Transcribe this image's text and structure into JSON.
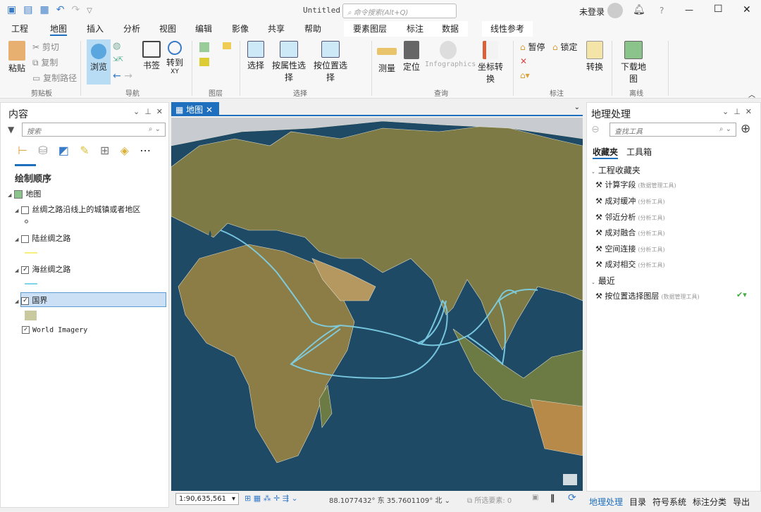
{
  "window": {
    "title": "Untitled",
    "search_placeholder": "命令搜索(Alt+Q)",
    "user": "未登录",
    "help": "?",
    "minimize": "—",
    "maximize": "☐",
    "close": "✕"
  },
  "menu_tabs": [
    "工程",
    "地图",
    "插入",
    "分析",
    "视图",
    "编辑",
    "影像",
    "共享",
    "帮助"
  ],
  "active_tab": "地图",
  "context_tabs": [
    "要素图层",
    "标注",
    "数据"
  ],
  "context_tab2": "线性参考",
  "ribbon": {
    "clipboard": {
      "paste": "粘贴",
      "cut": "剪切",
      "copy": "复制",
      "copy_path": "复制路径",
      "group": "剪贴板"
    },
    "navigate": {
      "explore": "浏览",
      "bookmarks": "书签",
      "goto": "转到",
      "goto_sub": "XY",
      "group": "导航"
    },
    "layer": {
      "group": "图层"
    },
    "selection": {
      "select": "选择",
      "by_attr": "按属性选择",
      "by_loc": "按位置选择",
      "group": "选择"
    },
    "inquiry": {
      "measure": "测量",
      "locate": "定位",
      "infographics": "Infographics",
      "convert_coord": "坐标转换",
      "group": "查询"
    },
    "labeling": {
      "pause": "暂停",
      "lock": "锁定",
      "convert": "转换",
      "group": "标注"
    },
    "offline": {
      "download": "下载地图",
      "group": "离线"
    }
  },
  "contents": {
    "title": "内容",
    "search_placeholder": "搜索",
    "drawing_order": "绘制顺序",
    "map": "地图",
    "layers": [
      {
        "name": "丝绸之路沿线上的城镇或者地区",
        "checked": false
      },
      {
        "name": "陆丝绸之路",
        "checked": false,
        "color": "#f5f07a"
      },
      {
        "name": "海丝绸之路",
        "checked": true,
        "color": "#7fd3ea"
      },
      {
        "name": "国界",
        "checked": true,
        "selected": true,
        "color": "#c9c9a0"
      },
      {
        "name": "World Imagery",
        "checked": true
      }
    ]
  },
  "map_tab": {
    "label": "地图"
  },
  "status": {
    "scale": "1:90,635,561",
    "coords": "88.1077432° 东 35.7601109° 北",
    "selected": "所选要素: 0"
  },
  "geoprocessing": {
    "title": "地理处理",
    "search_placeholder": "查找工具",
    "tabs": [
      "收藏夹",
      "工具箱"
    ],
    "project_fav": "工程收藏夹",
    "tools": [
      {
        "name": "计算字段",
        "box": "(数据管理工具)"
      },
      {
        "name": "成对缓冲",
        "box": "(分析工具)"
      },
      {
        "name": "邻近分析",
        "box": "(分析工具)"
      },
      {
        "name": "成对融合",
        "box": "(分析工具)"
      },
      {
        "name": "空间连接",
        "box": "(分析工具)"
      },
      {
        "name": "成对相交",
        "box": "(分析工具)"
      }
    ],
    "recent_label": "最近",
    "recent": [
      {
        "name": "按位置选择图层",
        "box": "(数据管理工具)"
      }
    ]
  },
  "bottom_tabs": [
    "地理处理",
    "目录",
    "符号系统",
    "标注分类",
    "导出"
  ],
  "colors": {
    "accent": "#1f6fbf",
    "selected_row": "#cce0f5",
    "sea_route": "#7fd3ea",
    "ocean": "#1e4a66"
  }
}
